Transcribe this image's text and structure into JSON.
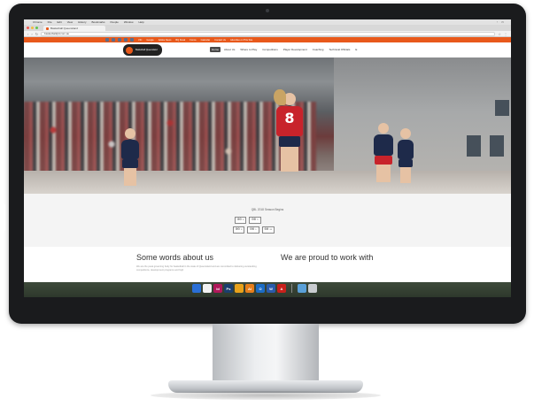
{
  "mac_menubar": {
    "items": [
      "",
      "Chrome",
      "File",
      "Edit",
      "View",
      "History",
      "Bookmarks",
      "People",
      "Window",
      "Help"
    ],
    "status": ""
  },
  "browser": {
    "tab_title": "Basketball Queensland",
    "url": "basketballqld.com.au"
  },
  "site": {
    "topbar_links": [
      "VIC",
      "Google",
      "Adobe News",
      "BQ Kiosk",
      "Forms",
      "Calendar",
      "Contact Us",
      "Advertise on This Site"
    ],
    "logo_text": "Basketball Queensland",
    "nav": [
      {
        "label": "Home",
        "active": true
      },
      {
        "label": "About Us",
        "active": false
      },
      {
        "label": "Where to Play",
        "active": false
      },
      {
        "label": "Competitions",
        "active": false
      },
      {
        "label": "Player Development",
        "active": false
      },
      {
        "label": "Coaching",
        "active": false
      },
      {
        "label": "Technical Officials",
        "active": false
      },
      {
        "label": "E",
        "active": false
      }
    ],
    "hero": {
      "jersey_number": "8"
    },
    "countdown": {
      "title": "QBL 2018 Season Begins",
      "row1": [
        {
          "value": "00",
          "unit": "d"
        },
        {
          "value": "00",
          "unit": "h"
        }
      ],
      "row2": [
        {
          "value": "00",
          "unit": "m"
        },
        {
          "value": "00",
          "unit": "s"
        },
        {
          "value": "00",
          "unit": "ms"
        }
      ]
    },
    "about_heading": "Some words about us",
    "partners_heading": "We are proud to work with",
    "about_text": "We are the peak governing body for basketball in the state of Queensland and are committed to delivering outstanding competitions, development programs and high"
  },
  "dock": {
    "apps": [
      {
        "name": "finder",
        "color": "#2a6fd6",
        "glyph": ""
      },
      {
        "name": "calendar",
        "color": "#f2f2f2",
        "glyph": ""
      },
      {
        "name": "indesign",
        "color": "#b0185a",
        "glyph": "Id"
      },
      {
        "name": "photoshop",
        "color": "#1b3f6e",
        "glyph": "Ps"
      },
      {
        "name": "chrome",
        "color": "#e8a21b",
        "glyph": ""
      },
      {
        "name": "illustrator",
        "color": "#e67e1b",
        "glyph": "Ai"
      },
      {
        "name": "outlook",
        "color": "#1c6cc4",
        "glyph": "O"
      },
      {
        "name": "word",
        "color": "#2b5bab",
        "glyph": "W"
      },
      {
        "name": "acrobat",
        "color": "#c8201b",
        "glyph": "A"
      }
    ],
    "trailing": [
      {
        "name": "downloads-folder",
        "color": "#5aa0d8",
        "glyph": ""
      },
      {
        "name": "trash",
        "color": "#c9ccd0",
        "glyph": ""
      }
    ]
  },
  "colors": {
    "brand_orange": "#e8591b",
    "bezel": "#1a1b1d",
    "jersey_red": "#c8232b",
    "jersey_navy": "#1e2a4a"
  }
}
